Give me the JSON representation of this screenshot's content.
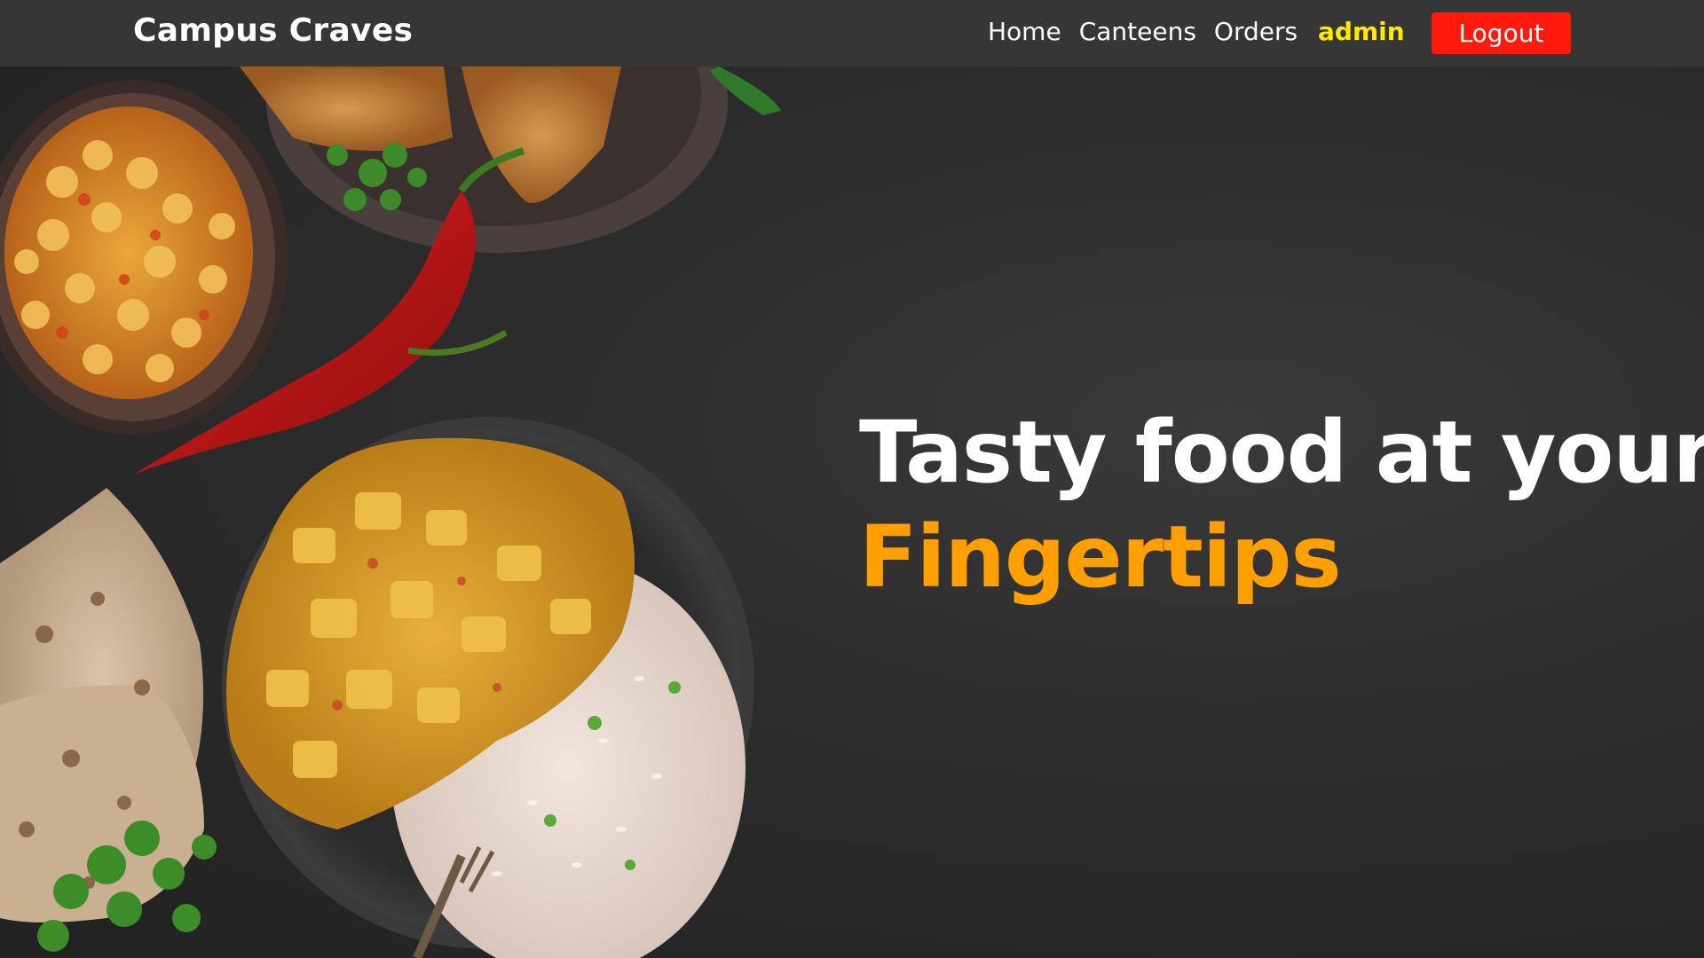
{
  "navbar": {
    "brand": "Campus Craves",
    "links": [
      "Home",
      "Canteens",
      "Orders"
    ],
    "user": "admin",
    "logout_label": "Logout"
  },
  "hero": {
    "line1": "Tasty food at your",
    "line2": "Fingertips"
  },
  "colors": {
    "navbar_bg": "#363636",
    "accent_orange": "#ffa000",
    "user_yellow": "#ffea00",
    "logout_red": "#ff1a0d"
  }
}
